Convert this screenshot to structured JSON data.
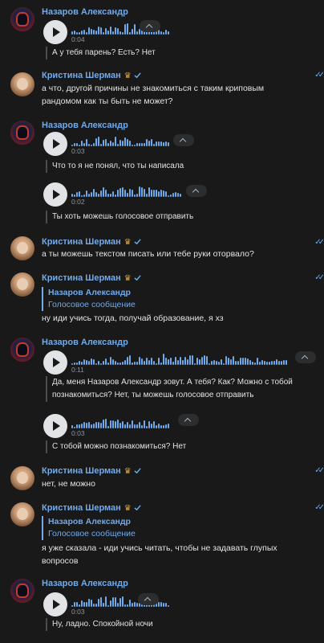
{
  "users": {
    "nazarov": "Назаров Александр",
    "kristina": "Кристина Шерман"
  },
  "messages": [
    {
      "type": "voice",
      "duration": "0:04",
      "transcript": "А у тебя парень? Есть? Нет"
    },
    {
      "type": "text",
      "text_lines": [
        "а что, другой причины не знакомиться с таким криповым",
        "рандомом как ты быть не может?"
      ]
    },
    {
      "type": "voice",
      "duration": "0:03",
      "transcript": "Что то я не понял, что ты написала"
    },
    {
      "type": "voice",
      "duration": "0:02",
      "transcript": "Ты хоть можешь голосовое отправить"
    },
    {
      "type": "text",
      "text_lines": [
        "а ты можешь текстом писать или тебе руки оторвало?"
      ]
    },
    {
      "type": "reply",
      "reply_name": "Назаров Александр",
      "reply_text": "Голосовое сообщение",
      "text_lines": [
        "ну иди учись тогда, получай образование, я хз"
      ]
    },
    {
      "type": "voice",
      "duration": "0:11",
      "transcript_lines": [
        "Да, меня Назаров Александр зовут. А тебя? Как? Можно с тобой",
        "познакомиться? Нет, ты можешь голосовое отправить"
      ]
    },
    {
      "type": "voice",
      "duration": "0:03",
      "transcript": "С тобой можно познакомиться? Нет"
    },
    {
      "type": "text",
      "text_lines": [
        "нет, не можно"
      ]
    },
    {
      "type": "reply",
      "reply_name": "Назаров Александр",
      "reply_text": "Голосовое сообщение",
      "text_lines": [
        "я уже сказала - иди учись читать, чтобы не задавать глупых",
        "вопросов"
      ]
    },
    {
      "type": "voice",
      "duration": "0:03",
      "transcript": "Ну, ладно. Спокойной ночи"
    }
  ],
  "icons": {
    "crown": "crown-icon",
    "verified": "verified-icon",
    "read": "double-check-icon",
    "play": "play-icon",
    "expand": "chevron-up-icon"
  },
  "colors": {
    "background": "#19191a",
    "accent": "#71aaeb",
    "text": "#e1e3e6",
    "muted": "#8f959c",
    "crown": "#e0a43a"
  }
}
